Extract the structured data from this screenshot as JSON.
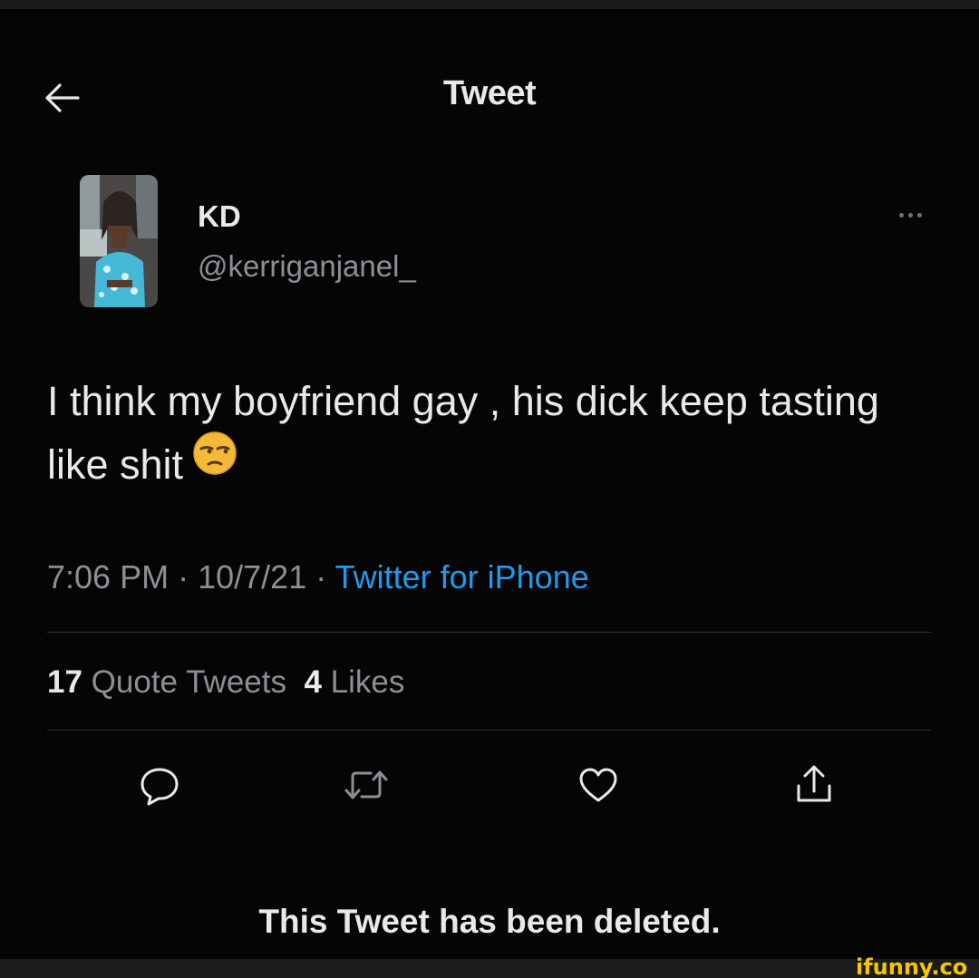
{
  "header": {
    "title": "Tweet",
    "back_icon": "arrow-left-icon"
  },
  "author": {
    "display_name": "KD",
    "username": "@kerriganjanel_",
    "avatar_icon": "profile-photo"
  },
  "tweet": {
    "text": "I think my boyfriend gay , his dick keep tasting like shit",
    "emoji_icon": "unamused-face-emoji",
    "time": "7:06 PM",
    "date": "10/7/21",
    "separator": "·",
    "source": "Twitter for iPhone"
  },
  "stats": {
    "quote_count": "17",
    "quote_label": "Quote Tweets",
    "like_count": "4",
    "like_label": "Likes"
  },
  "actions": [
    {
      "name": "reply",
      "icon": "reply-icon"
    },
    {
      "name": "retweet",
      "icon": "retweet-icon"
    },
    {
      "name": "like",
      "icon": "heart-icon"
    },
    {
      "name": "share",
      "icon": "share-icon"
    }
  ],
  "notice": {
    "text": "This Tweet has been deleted."
  },
  "watermark": {
    "text": "ifunny.co",
    "color": "#f7c500"
  },
  "colors": {
    "background": "#050505",
    "primary_text": "#e7e9ea",
    "secondary_text": "#8b9096",
    "link": "#1d9bf0",
    "icon": "#71767b"
  }
}
